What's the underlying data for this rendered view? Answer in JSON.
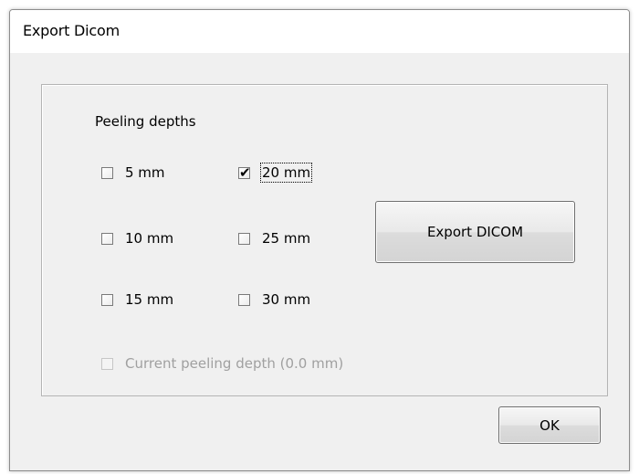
{
  "window": {
    "title": "Export Dicom"
  },
  "group": {
    "label": "Peeling depths"
  },
  "checkboxes": [
    {
      "label": "5 mm",
      "checked": false
    },
    {
      "label": "20 mm",
      "checked": true
    },
    {
      "label": "10 mm",
      "checked": false
    },
    {
      "label": "25 mm",
      "checked": false
    },
    {
      "label": "15 mm",
      "checked": false
    },
    {
      "label": "30 mm",
      "checked": false
    }
  ],
  "current_depth": {
    "label": "Current peeling depth (0.0 mm)",
    "checked": false,
    "enabled": false
  },
  "buttons": {
    "export_label": "Export DICOM",
    "ok_label": "OK"
  },
  "icons": {
    "check": "✔"
  }
}
